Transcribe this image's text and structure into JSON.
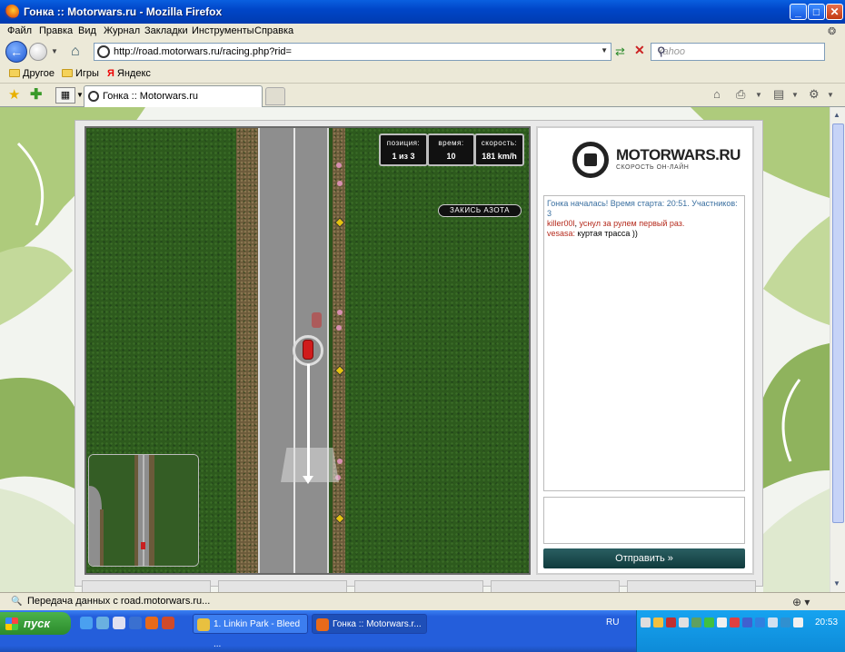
{
  "window": {
    "title": "Гонка :: Motorwars.ru - Mozilla Firefox",
    "minimize": "_",
    "maximize": "□",
    "close": "✕"
  },
  "menu": [
    "Файл",
    "Правка",
    "Вид",
    "Журнал",
    "Закладки",
    "Инструменты",
    "Справка"
  ],
  "nav": {
    "url": "http://road.motorwars.ru/racing.php?rid=",
    "search_placeholder": "Yahoo",
    "icons": [
      "back-arrow-icon",
      "forward-arrow-icon",
      "home-icon",
      "reload-icon",
      "stop-icon",
      "search-icon"
    ]
  },
  "bookmarks": [
    "Другое",
    "Игры",
    "Яндекс"
  ],
  "tab": {
    "label": "Гонка :: Motorwars.ru"
  },
  "game": {
    "hud": [
      {
        "label": "позиция:",
        "value": "1 из 3"
      },
      {
        "label": "время:",
        "value": "10"
      },
      {
        "label": "скорость:",
        "value": "181 km/h"
      }
    ],
    "nitro_label": "ЗАКИСЬ АЗОТА"
  },
  "sidebar": {
    "brand": "MOTORWARS.RU",
    "tagline": "СКОРОСТЬ ОН-ЛАЙН",
    "chat": [
      {
        "nick": "",
        "text": "Гонка началась! Время старта: 20:51. Участников: 3",
        "type": "system"
      },
      {
        "nick": "killer00l",
        "text": "уснул за рулем первый раз.",
        "type": "event"
      },
      {
        "nick": "vesasa:",
        "text": "куртая трасса ))",
        "type": "message"
      }
    ],
    "send_label": "Отправить »"
  },
  "status": {
    "text": "Передача данных с road.motorwars.ru..."
  },
  "taskbar": {
    "start_label": "пуск",
    "tasks": [
      "1. Linkin Park - Bleed ...",
      "Гонка :: Motorwars.r..."
    ],
    "lang": "RU",
    "clock": "20:53"
  },
  "colors": {
    "xp_blue": "#245edb",
    "grass": "#2d5a1d",
    "road": "#8e8e8e",
    "send_button": "#1f4d50",
    "chat_system": "#3a6fa0",
    "chat_event": "#b52a1c"
  }
}
